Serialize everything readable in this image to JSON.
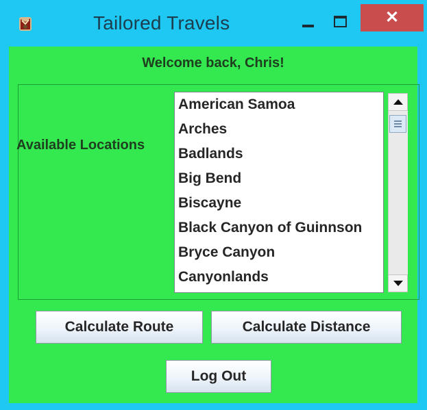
{
  "window": {
    "title": "Tailored Travels",
    "app_icon": "app-icon",
    "controls": {
      "minimize_icon": "minimize-icon",
      "maximize_icon": "maximize-icon",
      "close_label": "✕"
    },
    "colors": {
      "frame": "#1ec8f2",
      "content": "#33e94f",
      "close": "#c94d4d"
    }
  },
  "header": {
    "welcome_text": "Welcome back, Chris!"
  },
  "locations": {
    "label": "Available Locations",
    "items": [
      "American Samoa",
      "Arches",
      "Badlands",
      "Big Bend",
      "Biscayne",
      "Black Canyon of Guinnson",
      "Bryce Canyon",
      "Canyonlands"
    ]
  },
  "buttons": {
    "calculate_route": "Calculate Route",
    "calculate_distance": "Calculate Distance",
    "log_out": "Log Out"
  }
}
